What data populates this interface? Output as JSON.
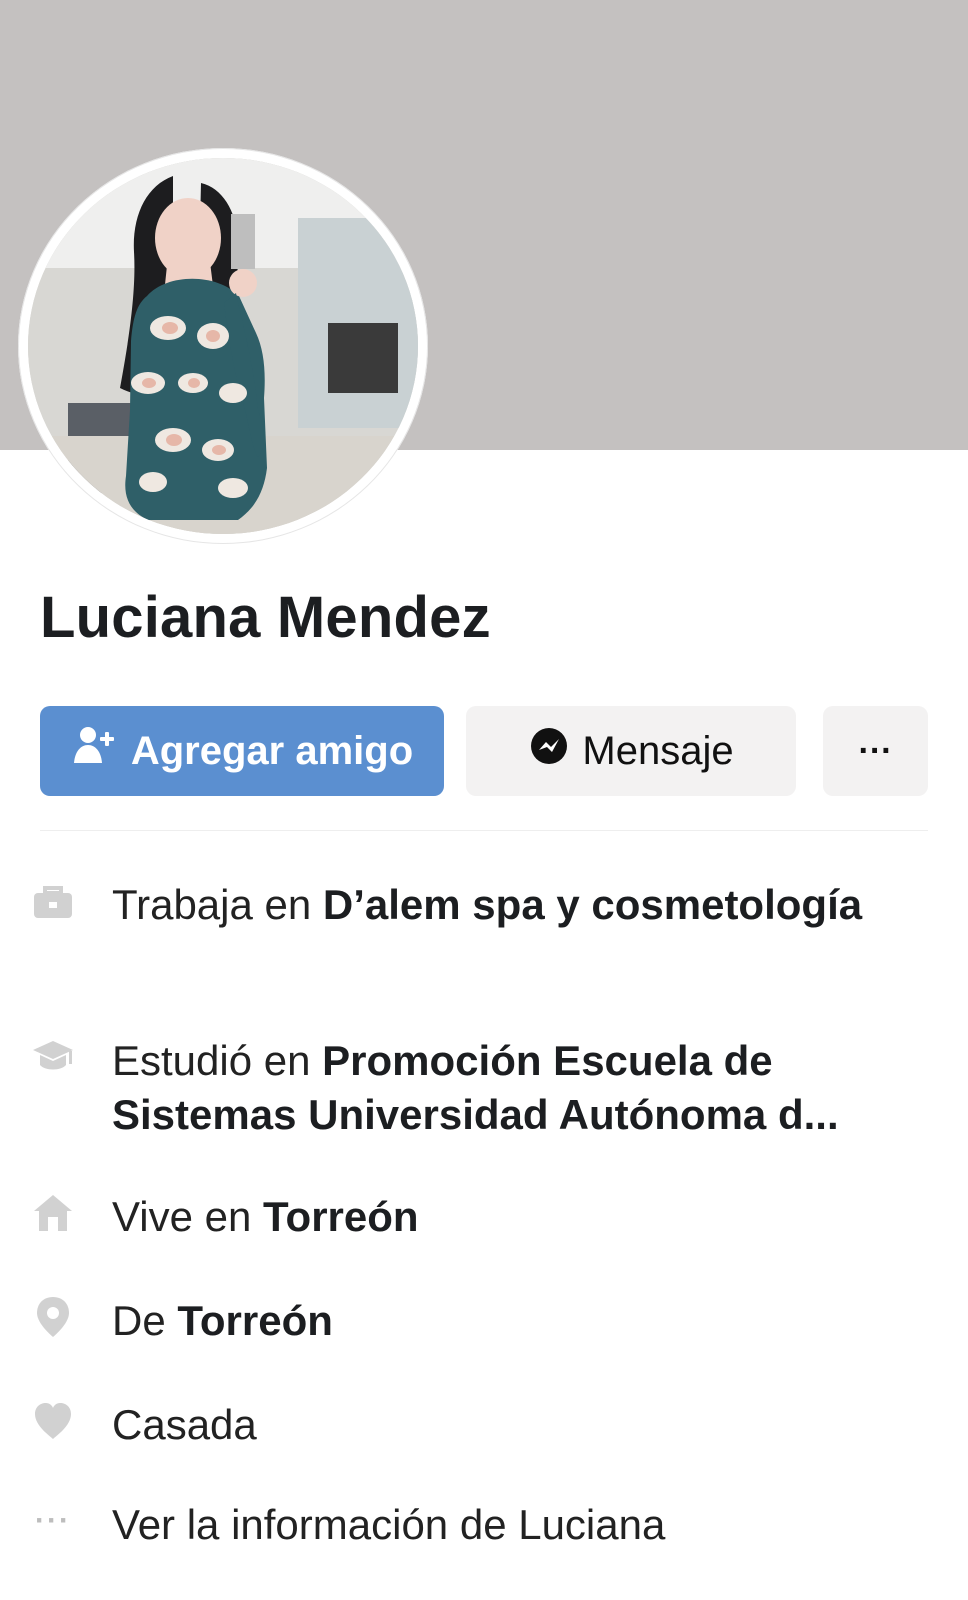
{
  "profile": {
    "name": "Luciana Mendez"
  },
  "actions": {
    "add_friend_label": "Agregar amigo",
    "message_label": "Mensaje",
    "more_label": "···"
  },
  "info": {
    "work": {
      "prefix": "Trabaja en ",
      "value": "D’alem spa y cosmetología"
    },
    "education": {
      "prefix": "Estudió en ",
      "value": "Promoción Escuela de Sistemas Universidad Autónoma d..."
    },
    "lives": {
      "prefix": "Vive en ",
      "value": "Torreón"
    },
    "from": {
      "prefix": "De ",
      "value": "Torreón"
    },
    "relationship": {
      "value": "Casada"
    },
    "see_more": {
      "value": "Ver la información de Luciana"
    }
  },
  "icons": [
    "user-plus-icon",
    "messenger-icon",
    "more-icon",
    "briefcase-icon",
    "graduation-cap-icon",
    "home-icon",
    "location-pin-icon",
    "heart-icon",
    "dots-icon"
  ],
  "colors": {
    "cover": "#c4c1c0",
    "primary_button": "#5b8fd0",
    "secondary_button": "#f3f2f2",
    "icon_gray": "#d0d0d0"
  }
}
